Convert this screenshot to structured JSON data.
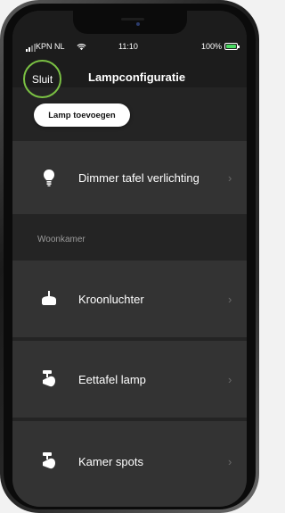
{
  "status_bar": {
    "carrier": "KPN NL",
    "time": "11:10",
    "battery": "100%"
  },
  "nav": {
    "close_label": "Sluit",
    "title": "Lampconfiguratie"
  },
  "add_lamp_label": "Lamp toevoegen",
  "groups": [
    {
      "name": "",
      "lamps": [
        {
          "label": "Dimmer tafel verlichting",
          "icon": "bulb-icon"
        }
      ]
    },
    {
      "name": "Woonkamer",
      "lamps": [
        {
          "label": "Kroonluchter",
          "icon": "pendant-lamp-icon"
        },
        {
          "label": "Eettafel lamp",
          "icon": "spot-lamp-icon"
        },
        {
          "label": "Kamer spots",
          "icon": "spot-lamp-icon"
        }
      ]
    }
  ],
  "colors": {
    "accent_ring": "#7ac043",
    "background": "#242424",
    "row": "#333333",
    "header": "#1c1c1c"
  }
}
